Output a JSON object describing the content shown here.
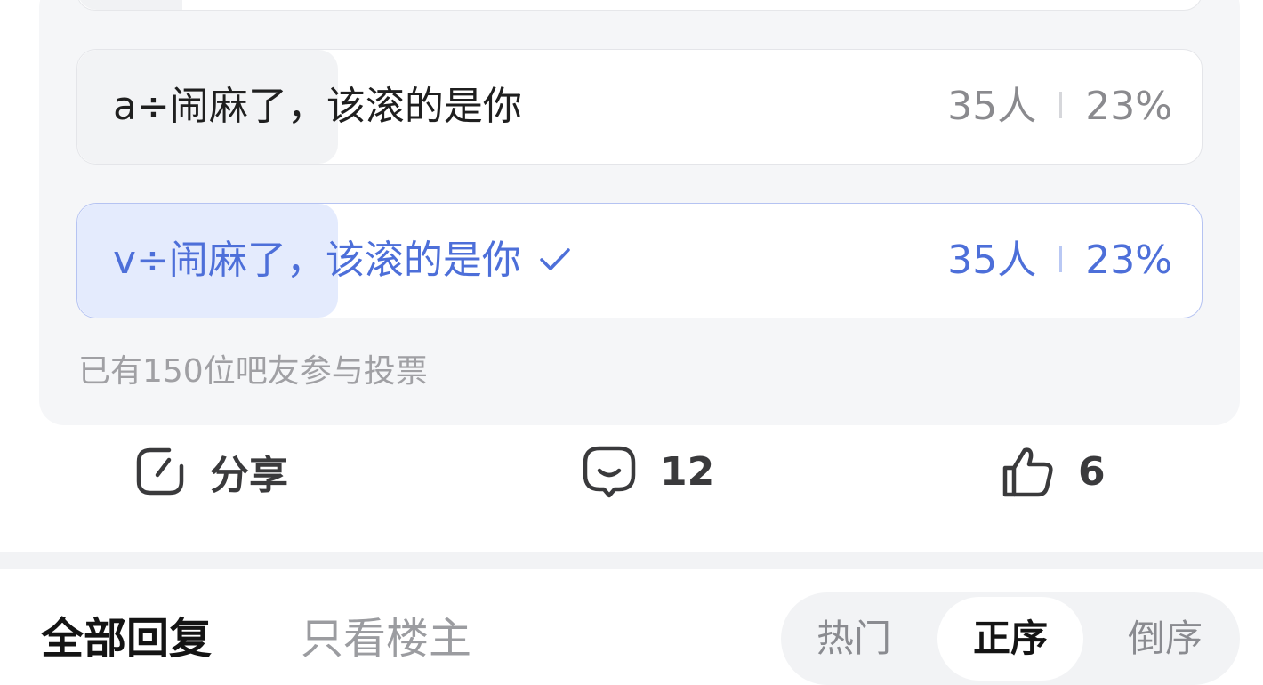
{
  "poll": {
    "options": [
      {
        "label": "a÷闹麻了，该滚的是你",
        "count": "35人",
        "percent": "23%",
        "selected": false
      },
      {
        "label": "v÷闹麻了，该滚的是你",
        "count": "35人",
        "percent": "23%",
        "selected": true,
        "check_icon": "checkmark-icon"
      }
    ],
    "participants_text": "已有150位吧友参与投票",
    "accent_color": "#4d6fd9"
  },
  "actions": {
    "share_label": "分享",
    "share_icon": "share-icon",
    "comment_count": "12",
    "comment_icon": "comment-icon",
    "like_count": "6",
    "like_icon": "thumbs-up-icon"
  },
  "replies": {
    "tabs": [
      {
        "label": "全部回复",
        "active": true
      },
      {
        "label": "只看楼主",
        "active": false
      }
    ],
    "sort": [
      {
        "label": "热门",
        "active": false
      },
      {
        "label": "正序",
        "active": true
      },
      {
        "label": "倒序",
        "active": false
      }
    ]
  }
}
